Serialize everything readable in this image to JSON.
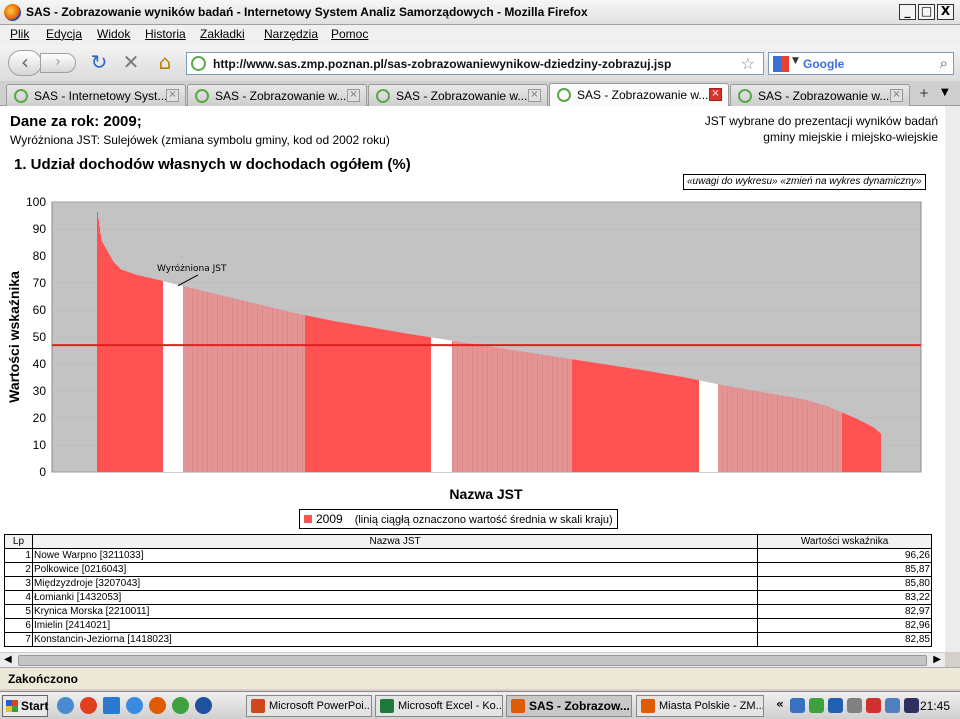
{
  "window": {
    "title": "SAS - Zobrazowanie wyników badań - Internetowy System Analiz Samorządowych - Mozilla Firefox",
    "minimize": "_",
    "maximize": "□",
    "close": "X"
  },
  "menu": [
    "Plik",
    "Edycja",
    "Widok",
    "Historia",
    "Zakładki",
    "Narzędzia",
    "Pomoc"
  ],
  "nav": {
    "url": "http://www.sas.zmp.poznan.pl/sas-zobrazowaniewynikow-dziedziny-zobrazuj.jsp",
    "search_placeholder": "Google"
  },
  "tabs": [
    {
      "label": "SAS - Internetowy Syst...",
      "active": false
    },
    {
      "label": "SAS - Zobrazowanie w...",
      "active": false
    },
    {
      "label": "SAS - Zobrazowanie w...",
      "active": false
    },
    {
      "label": "SAS - Zobrazowanie w...",
      "active": true
    },
    {
      "label": "SAS - Zobrazowanie w...",
      "active": false
    }
  ],
  "page": {
    "year_label": "Dane za rok: 2009;",
    "jst_label": "Wyróżniona JST: Sulejówek (zmiana symbolu gminy, kod od 2002 roku)",
    "right_line1": "JST wybrane do prezentacji wyników badań",
    "right_line2": "gminy miejskie i miejsko-wiejskie",
    "chart_title": "1. Udział dochodów własnych w dochodach ogółem (%)",
    "chart_links": "«uwagi do wykresu» «zmień na wykres dynamiczny»"
  },
  "chart_data": {
    "type": "area",
    "ylabel": "Wartości wskaźnika",
    "xlabel": "Nazwa JST",
    "ylim": [
      0,
      100
    ],
    "yticks": [
      0,
      10,
      20,
      30,
      40,
      50,
      60,
      70,
      80,
      90,
      100
    ],
    "series": [
      {
        "name": "2009",
        "color": "#ff5252",
        "x": [
          0,
          0.5,
          1,
          2,
          3,
          5,
          8,
          10,
          15,
          20,
          25,
          30,
          40,
          50,
          60,
          70,
          75,
          80,
          85,
          90,
          93,
          95,
          97,
          98,
          99,
          100
        ],
        "values": [
          96.26,
          85.8,
          83.2,
          78,
          75,
          73,
          71,
          69.5,
          66,
          62.5,
          59,
          56,
          51,
          46.5,
          42,
          37.5,
          35,
          32,
          29.5,
          27,
          24.5,
          22,
          19.5,
          18,
          16.5,
          14
        ]
      }
    ],
    "mean_line": 47,
    "highlighted_label": "Wyróżniona JST",
    "legend_note": "(linią ciągłą oznaczono wartość średnia w skali kraju)"
  },
  "table": {
    "headers": [
      "Lp",
      "Nazwa JST",
      "Wartości wskaźnika"
    ],
    "rows": [
      [
        "1",
        "Nowe Warpno [3211033]",
        "96,26"
      ],
      [
        "2",
        "Polkowice [0216043]",
        "85,87"
      ],
      [
        "3",
        "Międzyzdroje [3207043]",
        "85,80"
      ],
      [
        "4",
        "Łomianki [1432053]",
        "83,22"
      ],
      [
        "5",
        "Krynica Morska [2210011]",
        "82,97"
      ],
      [
        "6",
        "Imielin [2414021]",
        "82,96"
      ],
      [
        "7",
        "Konstancin-Jeziorna [1418023]",
        "82,85"
      ]
    ]
  },
  "status": {
    "text": "Zakończono"
  },
  "taskbar": {
    "start": "Start",
    "tasks": [
      {
        "label": "Microsoft PowerPoi...",
        "color": "#d2481e",
        "active": false
      },
      {
        "label": "Microsoft Excel - Ko...",
        "color": "#1f7a3a",
        "active": false
      },
      {
        "label": "SAS - Zobrazow...",
        "color": "#e05a00",
        "active": true
      },
      {
        "label": "Miasta Polskie - ZM...",
        "color": "#e05a00",
        "active": false
      }
    ],
    "tray_chevron": "«",
    "clock": "21:45"
  }
}
